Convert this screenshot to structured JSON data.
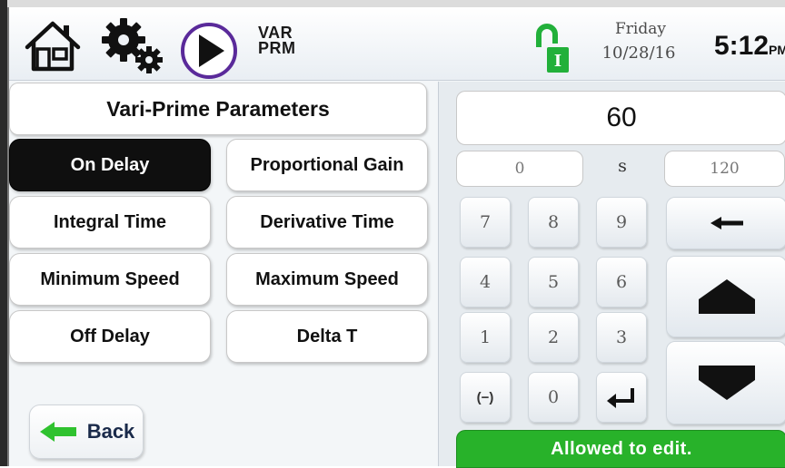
{
  "header": {
    "icons": [
      "home-icon",
      "gear-icon",
      "play-icon",
      "lock-icon"
    ],
    "mode_line1": "VAR",
    "mode_line2": "PRM",
    "day": "Friday",
    "date": "10/28/16",
    "time": "5:12",
    "ampm": "PM"
  },
  "left": {
    "title": "Vari-Prime Parameters",
    "buttons": [
      {
        "label": "On Delay",
        "selected": true
      },
      {
        "label": "Proportional Gain",
        "selected": false
      },
      {
        "label": "Integral Time",
        "selected": false
      },
      {
        "label": "Derivative Time",
        "selected": false
      },
      {
        "label": "Minimum Speed",
        "selected": false
      },
      {
        "label": "Maximum Speed",
        "selected": false
      },
      {
        "label": "Off Delay",
        "selected": false
      },
      {
        "label": "Delta T",
        "selected": false
      }
    ],
    "back_label": "Back"
  },
  "keypad": {
    "value": "60",
    "min": "0",
    "unit": "s",
    "max": "120",
    "keys": [
      "7",
      "8",
      "9",
      "4",
      "5",
      "6",
      "1",
      "2",
      "3",
      "(−)",
      "0"
    ],
    "icons": [
      "enter-icon",
      "backspace-icon",
      "arrow-up-icon",
      "arrow-down-icon"
    ],
    "status": "Allowed to edit."
  },
  "colors": {
    "selected_button": "#0f0f0f",
    "status_green": "#28b22a",
    "back_arrow_green": "#2fc22f",
    "lock_green": "#22b03a",
    "play_border": "#5a2a9a"
  }
}
